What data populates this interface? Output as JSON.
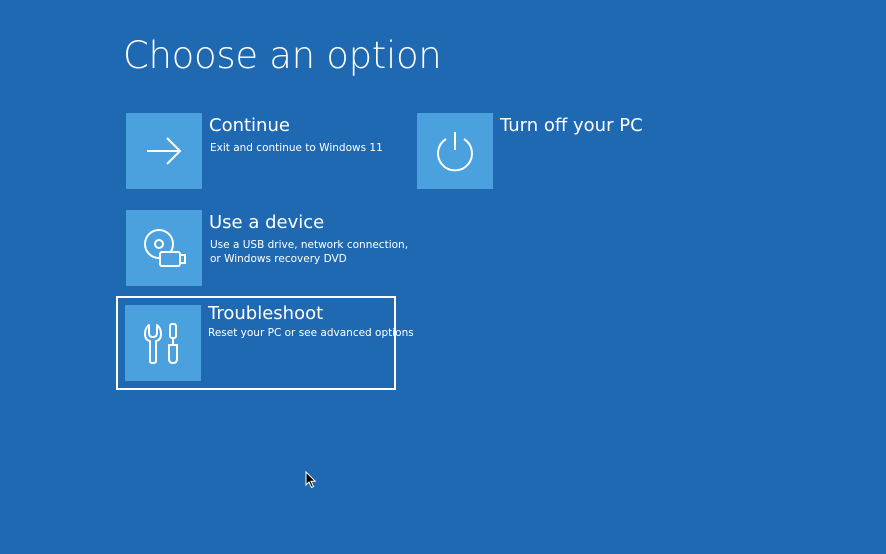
{
  "page": {
    "title": "Choose an option",
    "background_color": "#1f69b3",
    "tile_color": "#4aa1dd"
  },
  "options": [
    {
      "label": "Continue",
      "description_lines": [
        "Exit and continue to Windows 11"
      ],
      "icon": "arrow-right-icon"
    },
    {
      "label": "Use a device",
      "description_lines": [
        "Use a USB drive, network connection,",
        "or Windows recovery DVD"
      ],
      "icon": "usb-device-icon"
    },
    {
      "label": "Troubleshoot",
      "description_lines": [
        "Reset your PC or see advanced options"
      ],
      "icon": "tools-icon",
      "selected": true
    },
    {
      "label": "Turn off your PC",
      "description_lines": [],
      "icon": "power-icon"
    }
  ]
}
